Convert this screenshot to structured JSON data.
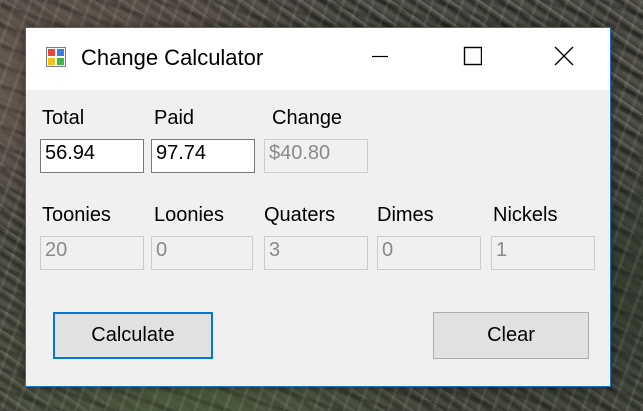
{
  "window": {
    "title": "Change Calculator",
    "icon": "app-window-icon",
    "controls": {
      "minimize": "minimize-icon",
      "maximize": "maximize-icon",
      "close": "close-icon"
    }
  },
  "inputs": {
    "total": {
      "label": "Total",
      "value": "56.94"
    },
    "paid": {
      "label": "Paid",
      "value": "97.74"
    },
    "change": {
      "label": "Change",
      "value": "$40.80"
    }
  },
  "coins": {
    "toonies": {
      "label": "Toonies",
      "value": "20"
    },
    "loonies": {
      "label": "Loonies",
      "value": "0"
    },
    "quarters": {
      "label": "Quaters",
      "value": "3"
    },
    "dimes": {
      "label": "Dimes",
      "value": "0"
    },
    "nickels": {
      "label": "Nickels",
      "value": "1"
    }
  },
  "buttons": {
    "calculate": "Calculate",
    "clear": "Clear"
  },
  "colors": {
    "accent": "#0078d7",
    "window_border": "#1a73c8",
    "form_background": "#f0f0f0",
    "disabled_text": "#8a8a8a"
  }
}
